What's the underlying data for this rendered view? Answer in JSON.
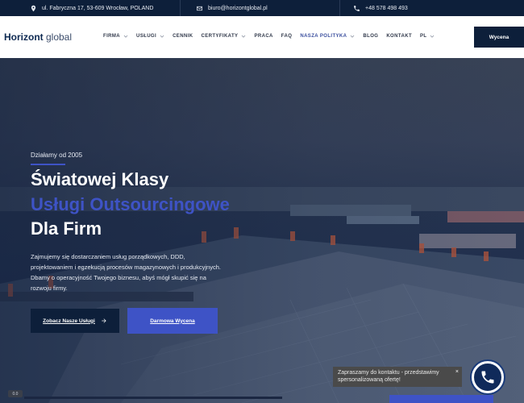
{
  "topbar": {
    "address": "ul. Fabryczna 17, 53-609 Wrocław, POLAND",
    "email": "biuro@horizontglobal.pl",
    "phone": "+48 578 498 493",
    "address_icon": "map-pin-icon",
    "email_icon": "envelope-icon",
    "phone_icon": "phone-icon"
  },
  "logo": {
    "brand": "Horizont",
    "suffix": " global"
  },
  "nav": {
    "items": [
      {
        "label": "FIRMA",
        "has_dropdown": true
      },
      {
        "label": "USŁUGI",
        "has_dropdown": true
      },
      {
        "label": "CENNIK",
        "has_dropdown": false
      },
      {
        "label": "CERTYFIKATY",
        "has_dropdown": true
      },
      {
        "label": "PRACA",
        "has_dropdown": false
      },
      {
        "label": "FAQ",
        "has_dropdown": false
      },
      {
        "label": "NASZA POLITYKA",
        "has_dropdown": true,
        "active": true
      },
      {
        "label": "BLOG",
        "has_dropdown": false
      },
      {
        "label": "KONTAKT",
        "has_dropdown": false
      },
      {
        "label": "PL",
        "has_dropdown": true
      }
    ],
    "cta": "Wycena"
  },
  "hero": {
    "since": "Działamy od 2005",
    "title_line1": "Światowej Klasy",
    "title_line2": "Usługi Outsourcingowe",
    "title_line3": "Dla Firm",
    "description": "Zajmujemy się dostarczaniem usług porządkowych, DDD, projektowaniem i egzekucją procesów magazynowych i produkcyjnych. Dbamy o operacyjność Twojego biznesu, abyś mógł skupić się na rozwoju firmy.",
    "button_primary": "Zobacz Nasze Usługi",
    "button_secondary": "Darmowa Wycena"
  },
  "chat": {
    "tooltip": "Zapraszamy do kontaktu - przedstawimy spersonalizowaną ofertę!",
    "close": "×"
  },
  "corner_badge": "0.0",
  "colors": {
    "navy": "#0d1f3a",
    "accent_blue": "#3e53c6",
    "active_nav": "#3a4e9e"
  }
}
